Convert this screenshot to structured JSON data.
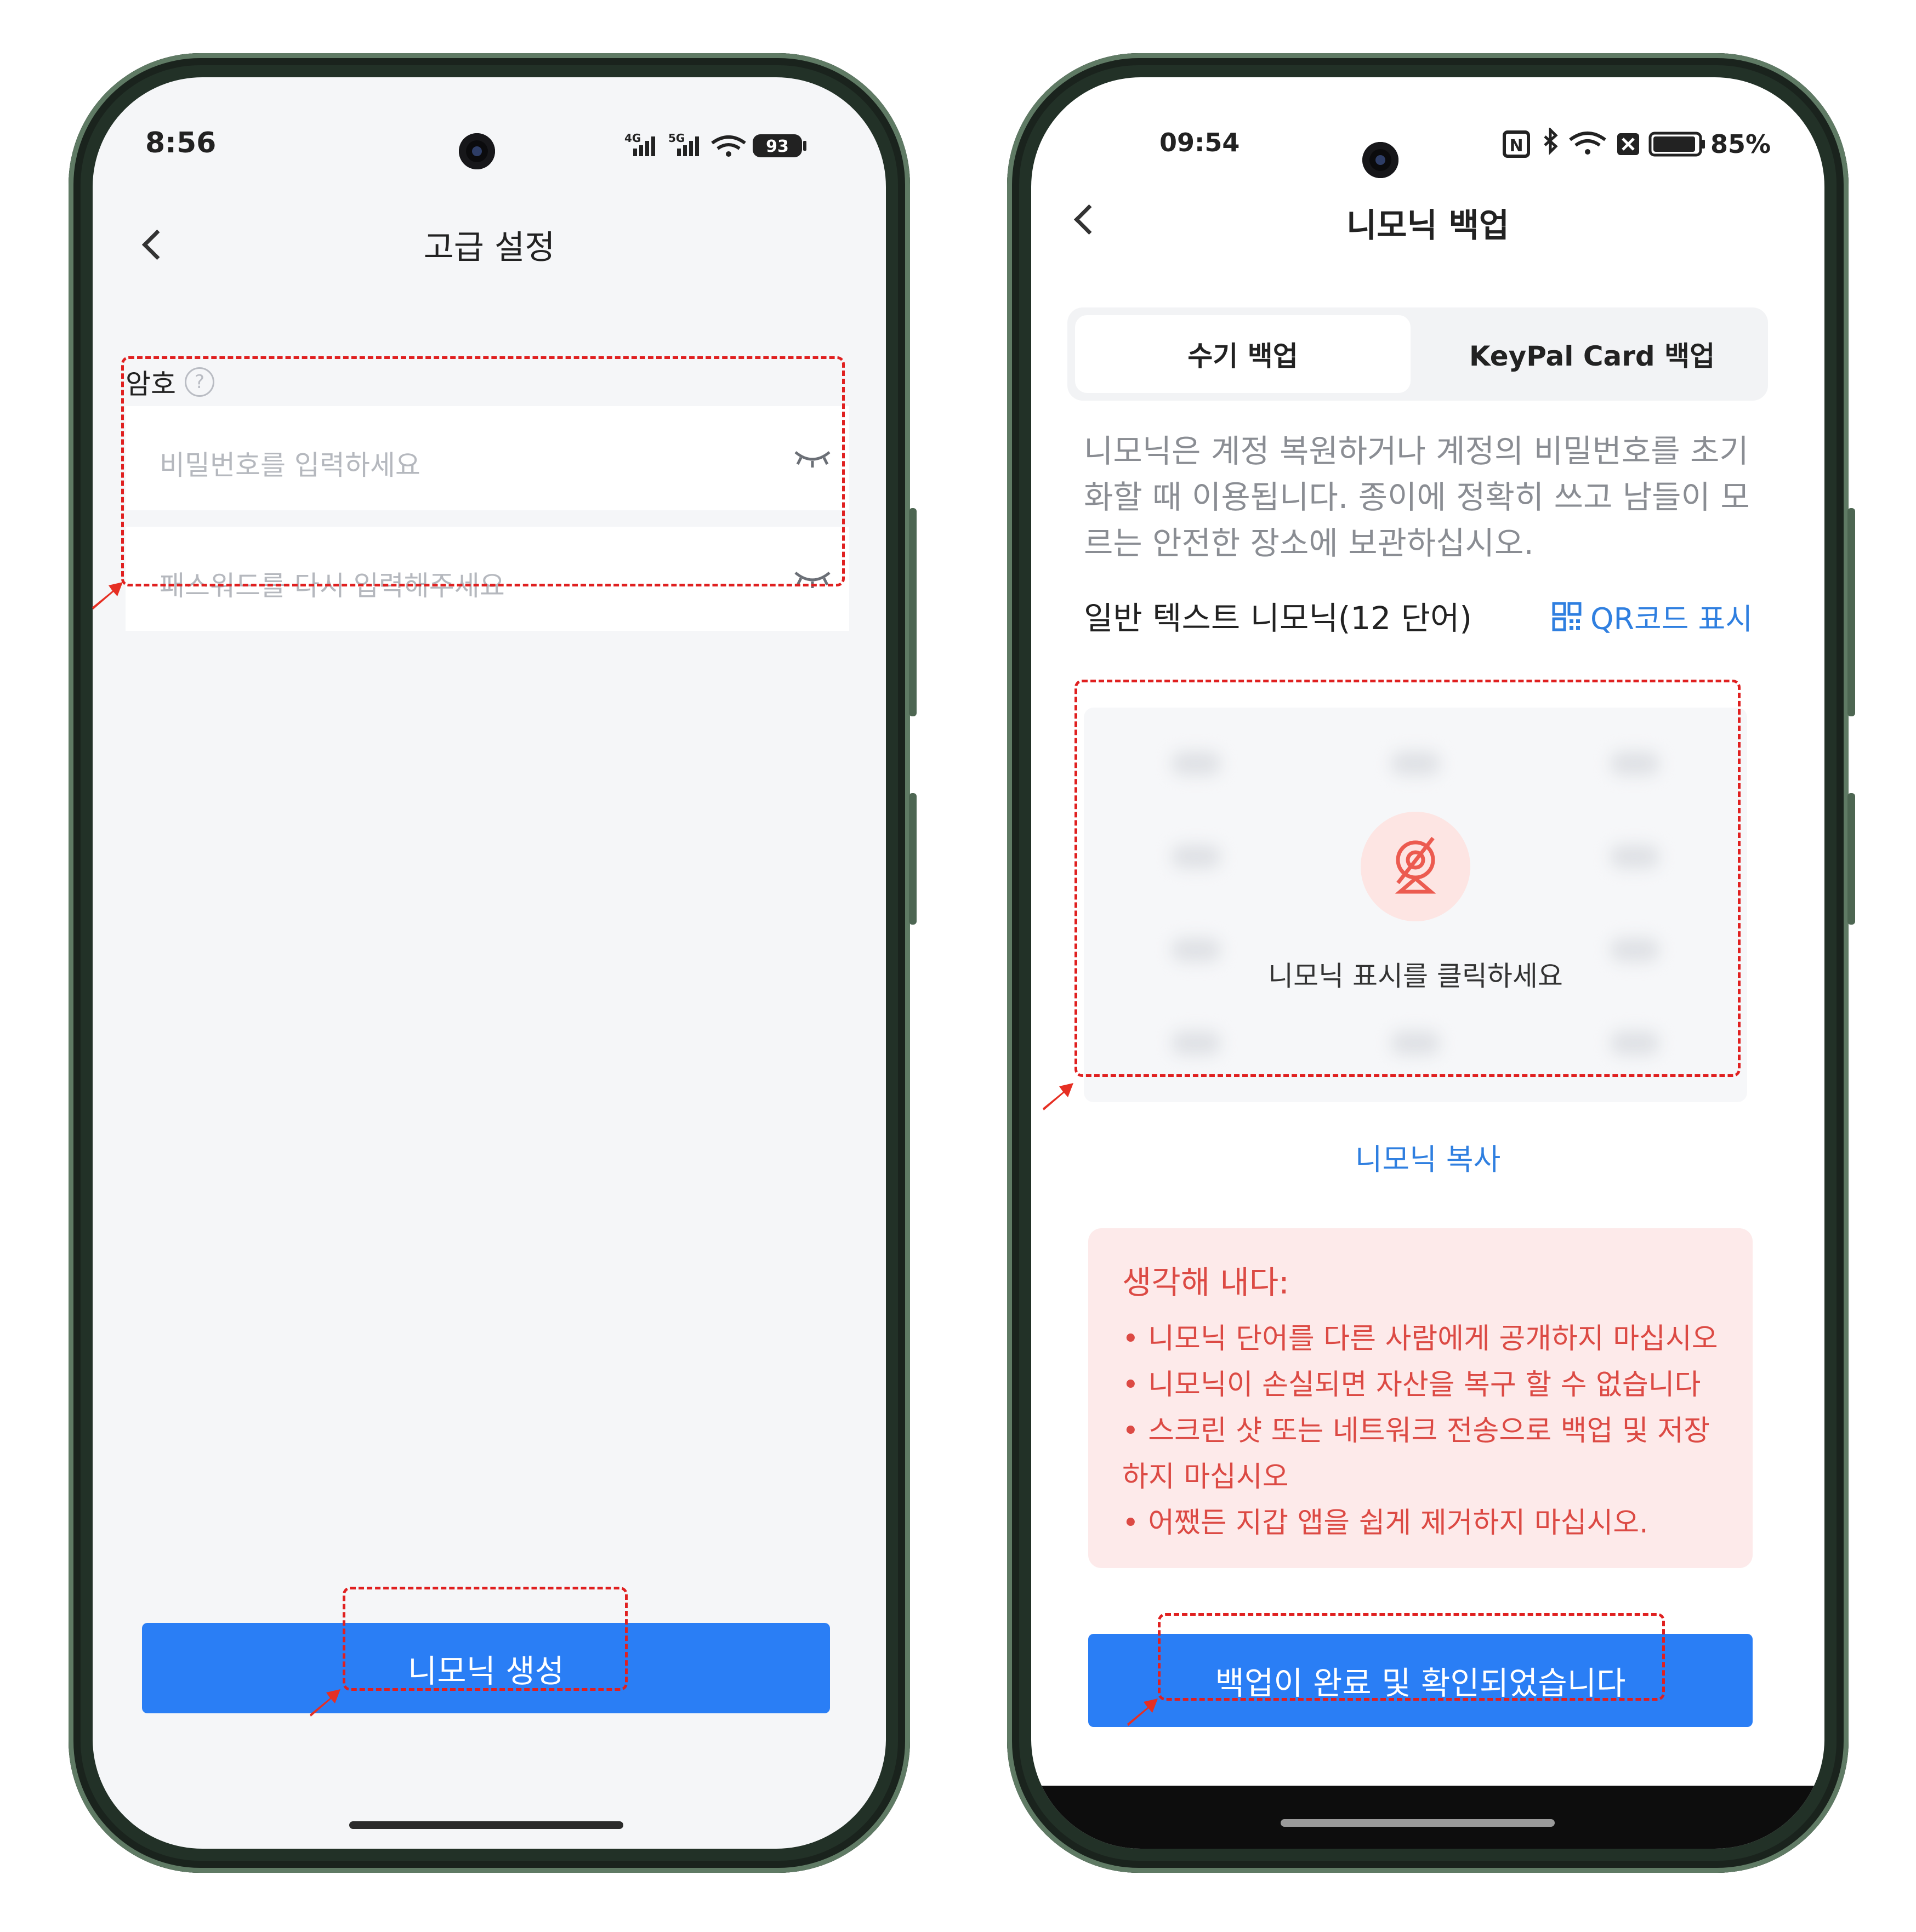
{
  "left": {
    "status": {
      "time": "8:56",
      "net1": "4G",
      "net2": "5G",
      "battery": "93"
    },
    "header": {
      "title": "고급 설정"
    },
    "password": {
      "label": "암호",
      "field1_placeholder": "비밀번호를 입력하세요",
      "field2_placeholder": "패스워드를 다시 입력해주세요"
    },
    "primary_button": "니모닉 생성"
  },
  "right": {
    "status": {
      "time": "09:54",
      "nfc": "N",
      "battery": "85%"
    },
    "header": {
      "title": "니모닉 백업"
    },
    "tabs": [
      {
        "label": "수기 백업"
      },
      {
        "label": "KeyPal Card 백업"
      }
    ],
    "description": "니모닉은 계정 복원하거나 계정의 비밀번호를 초기화할 때 이용됩니다. 종이에 정확히 쓰고 남들이 모르는 안전한 장소에 보관하십시오.",
    "mnemonic": {
      "section_title": "일반 텍스트 니모닉(12 단어)",
      "qr_link": "QR코드 표시",
      "reveal_text": "니모닉 표시를 클릭하세요",
      "copy_link": "니모닉 복사"
    },
    "warning": {
      "title": "생각해 내다:",
      "items": [
        "니모닉 단어를 다른 사람에게 공개하지 마십시오",
        "니모닉이 손실되면 자산을 복구 할 수 없습니다",
        "스크린 샷 또는 네트워크 전송으로 백업 및 저장하지 마십시오",
        "어쨌든 지갑 앱을 쉽게 제거하지 마십시오."
      ]
    },
    "primary_button": "백업이 완료 및 확인되었습니다"
  },
  "colors": {
    "accent_blue": "#2a7ef5",
    "link_blue": "#2f7fe0",
    "warning_bg": "#fdeaea",
    "warning_text": "#dc4a44",
    "annotation_red": "#e02020",
    "frame": "#223127"
  },
  "icons": [
    "back-chevron-icon",
    "help-circle-icon",
    "eye-closed-icon",
    "qr-code-icon",
    "eye-off-icon",
    "signal-icon",
    "wifi-icon",
    "battery-icon",
    "bluetooth-icon",
    "nfc-icon"
  ]
}
